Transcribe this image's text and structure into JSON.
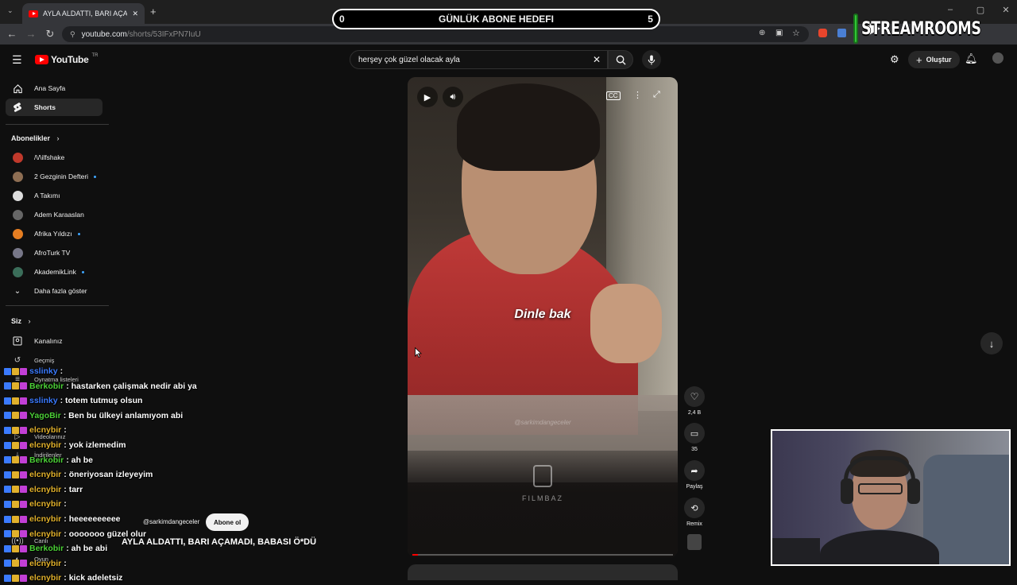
{
  "browser": {
    "tab_title": "AYLA ALDATTI, BARI AÇAMADI...",
    "url_domain": "youtube.com",
    "url_path": "/shorts/53IFxPN7IuU"
  },
  "goal": {
    "left_value": "0",
    "title": "GÜNLÜK ABONE HEDEFI",
    "right_value": "5"
  },
  "streamrooms": {
    "label": "STREAMROOMS"
  },
  "youtube": {
    "logo_text": "YouTube",
    "country": "TR",
    "search_value": "herşey çok güzel olacak ayla",
    "create_label": "Oluştur"
  },
  "sidebar": {
    "main": [
      {
        "label": "Ana Sayfa",
        "icon": "home-icon"
      },
      {
        "label": "Shorts",
        "icon": "shorts-icon"
      }
    ],
    "subscriptions_title": "Abonelikler",
    "subscriptions": [
      {
        "label": "/\\/\\ilfshake",
        "color": "#c0392b",
        "dot": false
      },
      {
        "label": "2 Gezginin Defteri",
        "color": "#8e6e53",
        "dot": true
      },
      {
        "label": "A Takımı",
        "color": "#dddddd",
        "dot": false
      },
      {
        "label": "Adem Karaaslan",
        "color": "#666666",
        "dot": false
      },
      {
        "label": "Afrika Yıldızı",
        "color": "#e67e22",
        "dot": true
      },
      {
        "label": "AfroTurk TV",
        "color": "#777788",
        "dot": false
      },
      {
        "label": "AkademikLink",
        "color": "#3b6e5a",
        "dot": true
      }
    ],
    "show_more_label": "Daha fazla göster",
    "you_title": "Siz",
    "you_items": [
      {
        "label": "Kanalınız"
      },
      {
        "label": "Geçmiş"
      },
      {
        "label": "Oynatma listeleri"
      },
      {
        "label": "Videolarınız"
      },
      {
        "label": "İndirilenler"
      },
      {
        "label": "Canlı"
      },
      {
        "label": "Oyun"
      }
    ]
  },
  "video": {
    "subtitle": "Dinle bak",
    "watermark": "@sarkimdangeceler",
    "brand": "FILMBAZ",
    "progress_fraction": 0.02
  },
  "actions": {
    "likes": "2,4 B",
    "comments": "35",
    "share_label": "Paylaş",
    "remix_label": "Remix"
  },
  "channel": {
    "handle": "@sarkimdangeceler",
    "subscribe_label": "Abone ol",
    "video_title": "AYLA ALDATTI, BARI AÇAMADI, BABASI Ö*DÜ"
  },
  "chat": [
    {
      "user": "sslinky",
      "msg": ":",
      "color": "#3b7bff"
    },
    {
      "user": "Berkobir",
      "msg": ": hastarken çalişmak nedir abi ya",
      "color": "#4cd137"
    },
    {
      "user": "sslinky",
      "msg": ": totem tutmuş olsun",
      "color": "#3b7bff"
    },
    {
      "user": "YagoBir",
      "msg": ": Ben bu ülkeyi anlamıyom abi",
      "color": "#4cd137"
    },
    {
      "user": "elcnybir",
      "msg": ":",
      "color": "#e1b12c"
    },
    {
      "user": "elcnybir",
      "msg": ": yok izlemedim",
      "color": "#e1b12c"
    },
    {
      "user": "Berkobir",
      "msg": ": ah be",
      "color": "#4cd137"
    },
    {
      "user": "elcnybir",
      "msg": ": öneriyosan izleyeyim",
      "color": "#e1b12c"
    },
    {
      "user": "elcnybir",
      "msg": ": tarr",
      "color": "#e1b12c"
    },
    {
      "user": "elcnybir",
      "msg": ":",
      "color": "#e1b12c"
    },
    {
      "user": "elcnybir",
      "msg": ": heeeeeeeeee",
      "color": "#e1b12c"
    },
    {
      "user": "elcnybir",
      "msg": ": ooooooo güzel olur",
      "color": "#e1b12c"
    },
    {
      "user": "Berkobir",
      "msg": ": ah be abi",
      "color": "#4cd137"
    },
    {
      "user": "elcnybir",
      "msg": ":",
      "color": "#e1b12c"
    },
    {
      "user": "elcnybir",
      "msg": ": kick adeletsiz",
      "color": "#e1b12c"
    }
  ]
}
